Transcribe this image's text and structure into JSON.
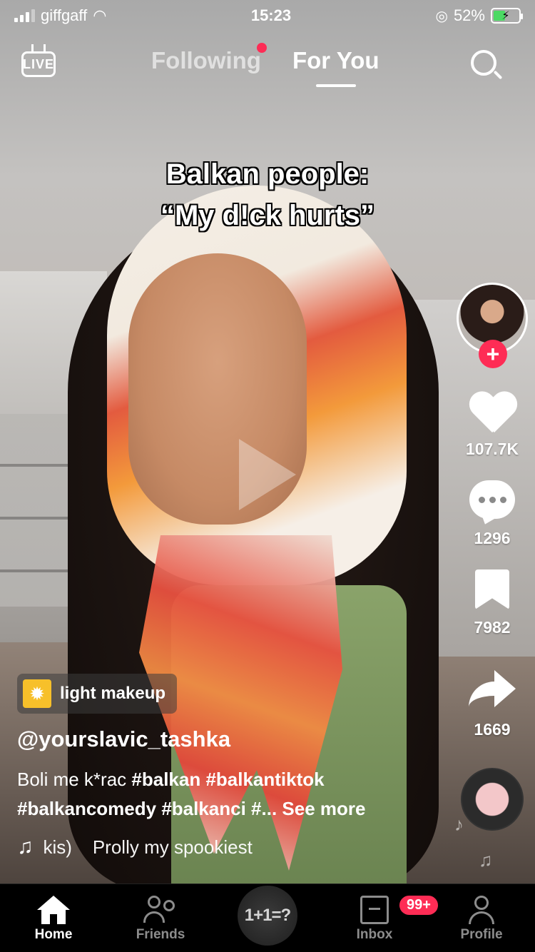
{
  "status_bar": {
    "carrier": "giffgaff",
    "time": "15:23",
    "battery_percent": "52%",
    "battery_level": 0.52
  },
  "top_nav": {
    "live_label": "LIVE",
    "tab_following": "Following",
    "tab_for_you": "For You",
    "active_tab": "For You"
  },
  "video": {
    "caption_line1": "Balkan people:",
    "caption_line2": "“My d!ck hurts”"
  },
  "rail": {
    "likes": "107.7K",
    "comments": "1296",
    "saves": "7982",
    "shares": "1669",
    "follow_symbol": "+"
  },
  "post": {
    "effect_label": "light makeup",
    "username": "@yourslavic_tashka",
    "description_text": "Boli me k*rac ",
    "hashtags_line1": "#balkan #balkantiktok",
    "hashtags_line2": "#balkancomedy #balkanci #...",
    "see_more": "See more",
    "sound": "kis)    Prolly my spookiest"
  },
  "tab_bar": {
    "home": "Home",
    "friends": "Friends",
    "create_label": "1+1=?",
    "inbox": "Inbox",
    "inbox_badge": "99+",
    "profile": "Profile"
  },
  "colors": {
    "accent": "#fe2c55",
    "battery_fill": "#4cd964",
    "effect_icon": "#f7c02a"
  }
}
